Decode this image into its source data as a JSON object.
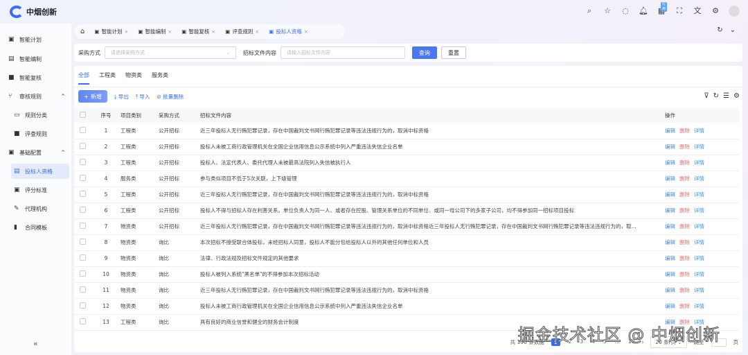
{
  "app": {
    "name": "中烟创新"
  },
  "header": {
    "badge": "应用"
  },
  "sidebar": {
    "items": [
      {
        "label": "智能计划",
        "icon": "▣"
      },
      {
        "label": "智能编制",
        "icon": "▤"
      },
      {
        "label": "智能复核",
        "icon": "■"
      },
      {
        "label": "审核规则",
        "icon": "⑂",
        "expand": "^"
      },
      {
        "label": "规则分类",
        "icon": "▭",
        "sub": true
      },
      {
        "label": "评查规则",
        "icon": "■",
        "sub": true
      },
      {
        "label": "基础配置",
        "icon": "▣",
        "expand": "^"
      },
      {
        "label": "投标人资格",
        "icon": "▤",
        "sub": true,
        "active": true
      },
      {
        "label": "评分标准",
        "icon": "▣",
        "sub": true
      },
      {
        "label": "代理机构",
        "icon": "✎",
        "sub": true
      },
      {
        "label": "合同模板",
        "icon": "▮",
        "sub": true
      }
    ],
    "collapse": "«"
  },
  "tabs": [
    {
      "label": "智能计划"
    },
    {
      "label": "智能编制"
    },
    {
      "label": "智能复核"
    },
    {
      "label": "评查规则"
    },
    {
      "label": "投标人资格",
      "active": true
    }
  ],
  "search": {
    "method_label": "采购方式",
    "method_placeholder": "请选择采购方式",
    "content_label": "招标文件内容",
    "content_placeholder": "请输入招标文件内容",
    "search_btn": "查询",
    "reset_btn": "重置"
  },
  "category_tabs": [
    "全部",
    "工程类",
    "物资类",
    "服务类"
  ],
  "toolbar": {
    "add": "新增",
    "export": "导出",
    "import": "导入",
    "batch_delete": "批量删除"
  },
  "table": {
    "headers": [
      "序号",
      "项目类别",
      "采购方式",
      "招标文件内容",
      "操作"
    ],
    "actions": {
      "edit": "编辑",
      "delete": "删除",
      "detail": "详情"
    },
    "rows": [
      [
        "1",
        "工程类",
        "公开招标",
        "近三年投标人无行贿犯罪记录，存在中国裁判文书网行贿犯罪记录等违法违规行为的，取消中标资格"
      ],
      [
        "2",
        "工程类",
        "公开招标",
        "投标人未被工商行政管理机关在全国企业信用信息公示系统中列入严重违法失信企业名单"
      ],
      [
        "3",
        "工程类",
        "公开招标",
        "投标人、法定代表人、委托代理人未被最高法院列入失信被执行人"
      ],
      [
        "4",
        "服务类",
        "公开招标",
        "参与类似项目不低于5次关联，上下级管理"
      ],
      [
        "5",
        "工程类",
        "公开招标",
        "近三年投标人无行贿犯罪记录，存在中国裁判文书网行贿犯罪记录等违法违规行为的，取消中标资格"
      ],
      [
        "6",
        "工程类",
        "公开招标",
        "投标人不得与招标人存在利害关系。单位负责人为同一人、或者存在控股、管理关系单位的不同单位、或同一母公司下的多家子公司，均不得参加同一招标项目投标"
      ],
      [
        "7",
        "物资类",
        "公开招标",
        "近三年投标人无行贿犯罪记录，存在中国裁判文书网行贿犯罪记录等违法违规行为的，取消中标资格近三年投标人无行贿犯罪记录，存在中国裁判文书网行贿犯罪记录等违法违规行为的，取..."
      ],
      [
        "8",
        "物资类",
        "询比",
        "本次招标不接受联合体投标，未经招标人同意，投标人不能分包给投标人以外的其他任何单位和人员"
      ],
      [
        "9",
        "物资类",
        "询比",
        "法律、行政法规及招标文件规定的其他要求"
      ],
      [
        "10",
        "物资类",
        "询比",
        "投标人被列入系统\"黑名单\"的不得参加本次招标活动"
      ],
      [
        "11",
        "物资类",
        "询比",
        "近三年投标人无行贿犯罪记录，存在中国裁判文书网行贿犯罪记录等违法违规行为的，取消中标资格"
      ],
      [
        "12",
        "物资类",
        "询比",
        "投标人未被工商行政管理机关在全国企业信用信息公示系统中列入严重违法失信企业名单"
      ],
      [
        "13",
        "工程类",
        "询比",
        "具有良好的商业信誉和健全的财务会计制度"
      ]
    ]
  },
  "pagination": {
    "total": "共 198 条数据",
    "pages": [
      "1",
      "2",
      "3",
      "4",
      "5",
      "...",
      "10"
    ],
    "next": "›",
    "page_size": "20 条/页",
    "goto": "跳至",
    "page_unit": "页"
  },
  "watermark": "掘金技术社区 @ 中烟创新"
}
